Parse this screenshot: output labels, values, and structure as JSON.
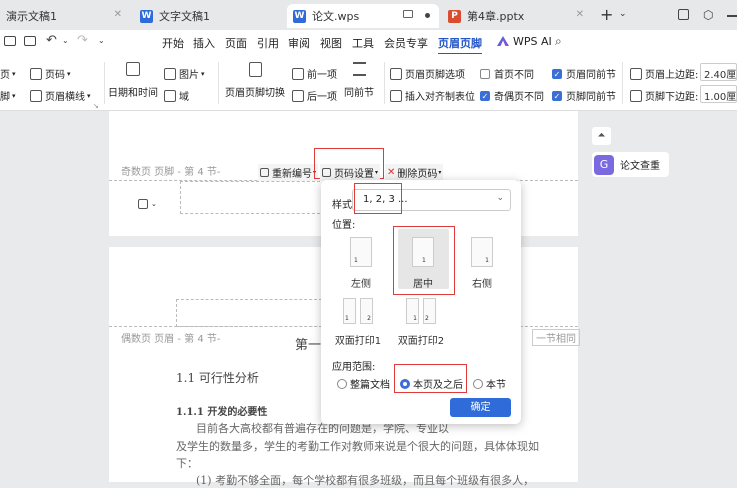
{
  "tabs": [
    {
      "label": "演示文稿1",
      "icon": ""
    },
    {
      "label": "文字文稿1",
      "icon": "W"
    },
    {
      "label": "论文.wps",
      "icon": "W"
    },
    {
      "label": "第4章.pptx",
      "icon": "P"
    }
  ],
  "menu": [
    "开始",
    "插入",
    "页面",
    "引用",
    "审阅",
    "视图",
    "工具",
    "会员专享",
    "页眉页脚",
    "WPS AI"
  ],
  "ribbon": {
    "page_number": "页码",
    "header": "页脚",
    "header_line": "页眉横线",
    "datetime": "日期和时间",
    "picture": "图片",
    "field": "域",
    "hf_switch": "页眉页脚切换",
    "prev": "前一项",
    "next": "后一项",
    "same_prev": "同前节",
    "hf_options": "页眉页脚选项",
    "insert_align_tab": "插入对齐制表位",
    "first_diff": "首页不同",
    "odd_even_diff": "奇偶页不同",
    "header_same_prev": "页眉同前节",
    "footer_same_prev": "页脚同前节",
    "header_top_label": "页眉上边距:",
    "header_top_value": "2.40厘",
    "footer_bottom_label": "页脚下边距:",
    "footer_bottom_value": "1.00厘"
  },
  "doc": {
    "odd_footer": "奇数页 页脚 - 第 4 节-",
    "even_header": "偶数页 页眉 - 第 4 节-",
    "renumber": "重新编号",
    "page_num_settings": "页码设置",
    "delete_page_num": "删除页码",
    "same_prev_note": "一节相同",
    "chapter": "第一",
    "section_title": "1.1  可行性分析",
    "subsection": "1.1.1  开发的必要性",
    "para1": "目前各大高校都有普遍存在的问题是，学院、专业以",
    "para2": "及学生的数量多，学生的考勤工作对教师来说是个很大的问题，具体体现如",
    "para3": "下：",
    "para4": "(1)  考勤不够全面，每个学校都有很多班级，而且每个班级有很多人，"
  },
  "side": {
    "paper_check": "论文查重"
  },
  "popup": {
    "style_label": "样式",
    "style_value": "1, 2, 3 ...",
    "position_label": "位置:",
    "positions": [
      "左侧",
      "居中",
      "右侧",
      "双面打印1",
      "双面打印2"
    ],
    "scope_label": "应用范围:",
    "scope_options": [
      "整篇文档",
      "本页及之后",
      "本节"
    ],
    "ok": "确定"
  },
  "colors": {
    "accent": "#3b6fd8",
    "highlight": "#e03b3b"
  }
}
